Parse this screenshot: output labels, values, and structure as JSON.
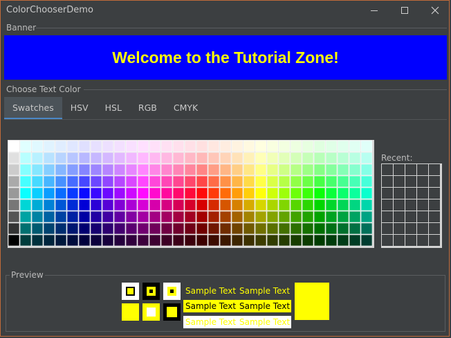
{
  "window": {
    "title": "ColorChooserDemo",
    "controls": [
      "minimize-icon",
      "maximize-icon",
      "close-icon"
    ]
  },
  "banner": {
    "group_label": "Banner",
    "text": "Welcome to the Tutorial Zone!",
    "background": "#0000ff",
    "foreground": "#ffff00"
  },
  "chooser": {
    "group_label": "Choose Text Color",
    "tabs": [
      {
        "label": "Swatches",
        "selected": true
      },
      {
        "label": "HSV",
        "selected": false
      },
      {
        "label": "HSL",
        "selected": false
      },
      {
        "label": "RGB",
        "selected": false
      },
      {
        "label": "CMYK",
        "selected": false
      }
    ],
    "recent_label": "Recent:",
    "swatch_grid": {
      "columns": 31,
      "rows": 9
    },
    "recent_grid": {
      "columns": 5,
      "rows": 7,
      "cell_color": "#3c3f41"
    }
  },
  "preview": {
    "group_label": "Preview",
    "sample_text": "Sample Text",
    "selected_color": "#ffff00"
  }
}
